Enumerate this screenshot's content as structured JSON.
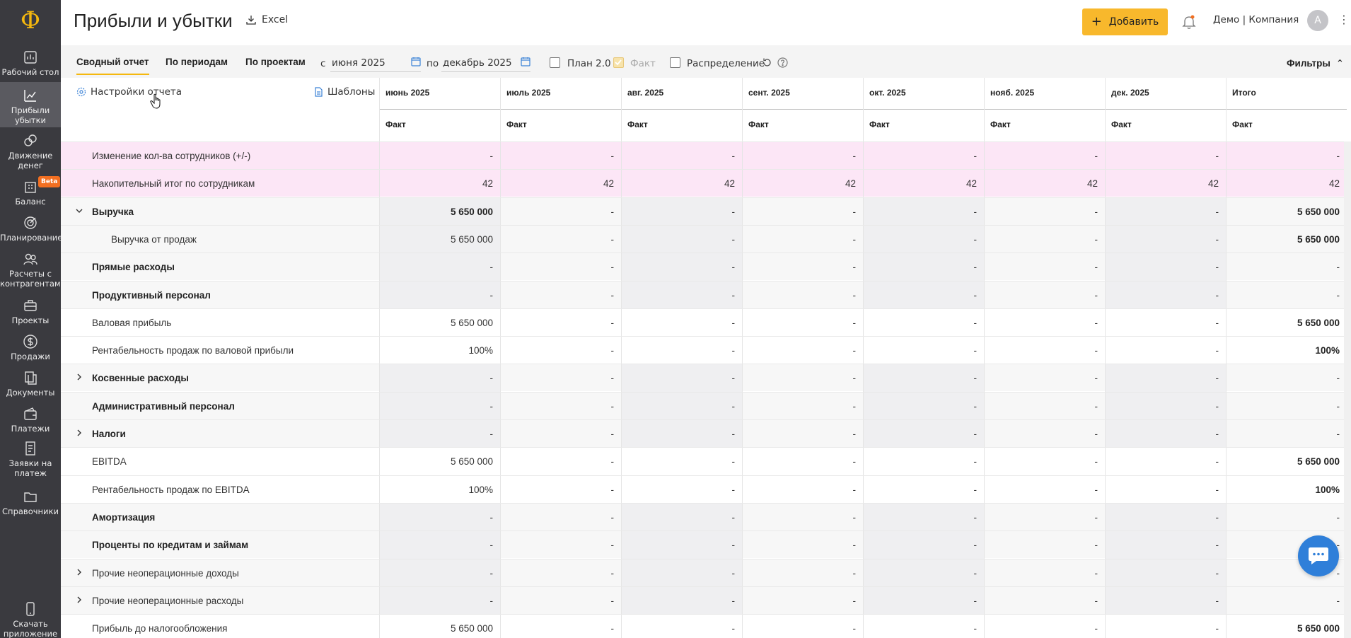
{
  "app": {
    "logo": "Ф"
  },
  "sidebar": {
    "items": [
      {
        "label": "Рабочий стол",
        "icon": "desktop-icon"
      },
      {
        "label": "Прибыли убытки",
        "icon": "chart-icon",
        "active": true
      },
      {
        "label": "Движение денег",
        "icon": "coins-icon"
      },
      {
        "label": "Баланс",
        "icon": "building-icon",
        "badge": "Beta"
      },
      {
        "label": "Планирование",
        "icon": "target-icon"
      },
      {
        "label": "Расчеты с контрагентами",
        "icon": "users-icon"
      },
      {
        "label": "Проекты",
        "icon": "briefcase-icon"
      },
      {
        "label": "Продажи",
        "icon": "dollar-icon"
      },
      {
        "label": "Документы",
        "icon": "documents-icon"
      },
      {
        "label": "Платежи",
        "icon": "wallet-icon"
      },
      {
        "label": "Заявки на платеж",
        "icon": "request-icon"
      },
      {
        "label": "Справочники",
        "icon": "folder-icon"
      }
    ],
    "download": "Скачать приложение"
  },
  "header": {
    "title": "Прибыли и убытки",
    "excel": "Excel",
    "add_button": "Добавить",
    "company": "Демо | Компания",
    "avatar": "А"
  },
  "toolbar": {
    "tabs": [
      "Сводный отчет",
      "По периодам",
      "По проектам"
    ],
    "from_label": "с",
    "from_value": "июня 2025",
    "to_label": "по",
    "to_value": "декабрь 2025",
    "plan_label": "План 2.0",
    "fact_label": "Факт",
    "distribution_label": "Распределение",
    "filters": "Фильтры"
  },
  "table": {
    "settings": "Настройки отчета",
    "templates": "Шаблоны",
    "columns": [
      "июнь 2025",
      "июль 2025",
      "авг. 2025",
      "сент. 2025",
      "окт. 2025",
      "нояб. 2025",
      "дек. 2025",
      "Итого"
    ],
    "subheader": "Факт",
    "rows": [
      {
        "label": "Изменение кол-ва сотрудников (+/-)",
        "values": [
          "-",
          "-",
          "-",
          "-",
          "-",
          "-",
          "-",
          "-"
        ]
      },
      {
        "label": "Накопительный итог по сотрудникам",
        "values": [
          "42",
          "42",
          "42",
          "42",
          "42",
          "42",
          "42",
          "42"
        ]
      },
      {
        "label": "Выручка",
        "values": [
          "5 650 000",
          "-",
          "-",
          "-",
          "-",
          "-",
          "-",
          "5 650 000"
        ]
      },
      {
        "label": "Выручка от продаж",
        "values": [
          "5 650 000",
          "-",
          "-",
          "-",
          "-",
          "-",
          "-",
          "5 650 000"
        ]
      },
      {
        "label": "Прямые расходы",
        "values": [
          "-",
          "-",
          "-",
          "-",
          "-",
          "-",
          "-",
          "-"
        ]
      },
      {
        "label": "Продуктивный персонал",
        "values": [
          "-",
          "-",
          "-",
          "-",
          "-",
          "-",
          "-",
          "-"
        ]
      },
      {
        "label": "Валовая прибыль",
        "values": [
          "5 650 000",
          "-",
          "-",
          "-",
          "-",
          "-",
          "-",
          "5 650 000"
        ]
      },
      {
        "label": "Рентабельность продаж по валовой прибыли",
        "values": [
          "100%",
          "-",
          "-",
          "-",
          "-",
          "-",
          "-",
          "100%"
        ]
      },
      {
        "label": "Косвенные расходы",
        "values": [
          "-",
          "-",
          "-",
          "-",
          "-",
          "-",
          "-",
          "-"
        ]
      },
      {
        "label": "Административный персонал",
        "values": [
          "-",
          "-",
          "-",
          "-",
          "-",
          "-",
          "-",
          "-"
        ]
      },
      {
        "label": "Налоги",
        "values": [
          "-",
          "-",
          "-",
          "-",
          "-",
          "-",
          "-",
          "-"
        ]
      },
      {
        "label": "EBITDA",
        "values": [
          "5 650 000",
          "-",
          "-",
          "-",
          "-",
          "-",
          "-",
          "5 650 000"
        ]
      },
      {
        "label": "Рентабельность продаж по EBITDA",
        "values": [
          "100%",
          "-",
          "-",
          "-",
          "-",
          "-",
          "-",
          "100%"
        ]
      },
      {
        "label": "Амортизация",
        "values": [
          "-",
          "-",
          "-",
          "-",
          "-",
          "-",
          "-",
          "-"
        ]
      },
      {
        "label": "Проценты по кредитам и займам",
        "values": [
          "-",
          "-",
          "-",
          "-",
          "-",
          "-",
          "-",
          "-"
        ]
      },
      {
        "label": "Прочие неоперационные доходы",
        "values": [
          "-",
          "-",
          "-",
          "-",
          "-",
          "-",
          "-",
          "-"
        ]
      },
      {
        "label": "Прочие неоперационные расходы",
        "values": [
          "-",
          "-",
          "-",
          "-",
          "-",
          "-",
          "-",
          "-"
        ]
      },
      {
        "label": "Прибыль до налогообложения",
        "values": [
          "5 650 000",
          "-",
          "-",
          "-",
          "-",
          "-",
          "-",
          "5 650 000"
        ]
      }
    ]
  },
  "colors": {
    "accent": "#f8b82c",
    "sidebar": "#3a3a3f",
    "pink_row": "#fce6f6",
    "chat": "#2f7fd9"
  }
}
